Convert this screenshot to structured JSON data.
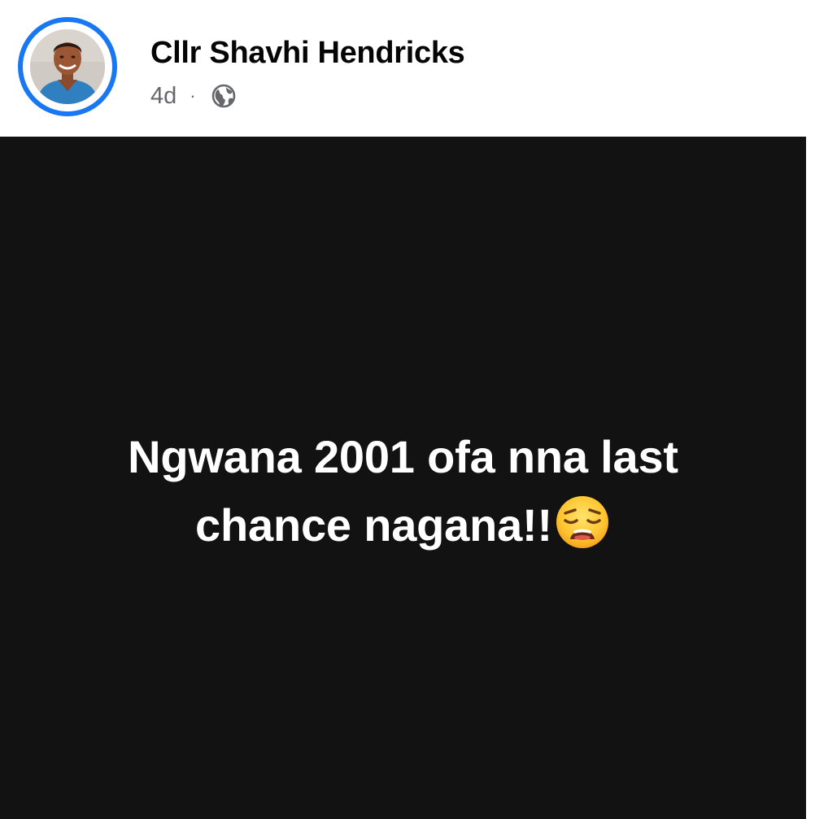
{
  "post": {
    "author": {
      "name": "Cllr Shavhi Hendricks",
      "avatar_icon": "profile-photo"
    },
    "meta": {
      "time": "4d",
      "separator": "·",
      "audience_icon": "globe-icon"
    },
    "text_card": {
      "line1": "Ngwana 2001 ofa nna last",
      "line2": "chance nagana!!",
      "emoji": "weary-face-emoji",
      "background": "#121212",
      "text_color": "#ffffff"
    }
  },
  "colors": {
    "accent": "#1877f2",
    "name": "#050505",
    "meta": "#65676b"
  }
}
